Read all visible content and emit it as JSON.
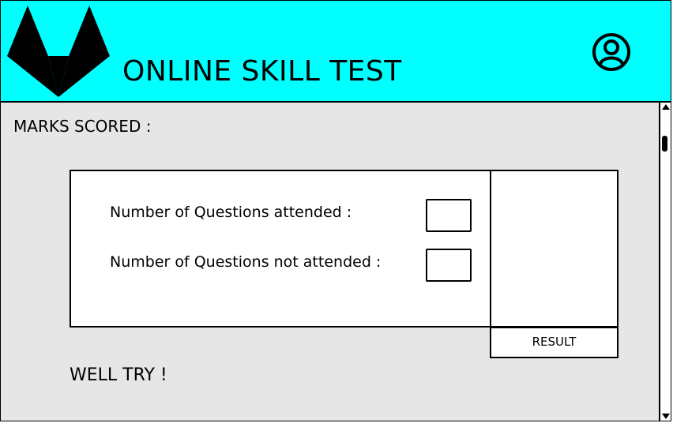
{
  "header": {
    "title": "ONLINE SKILL TEST",
    "background_color": "#00ffff",
    "logo_icon": "fox-logo-icon",
    "user_icon": "user-avatar-icon"
  },
  "main": {
    "marks_label": "MARKS SCORED  :",
    "questions_attended_label": "Number of Questions attended :",
    "questions_attended_value": "",
    "questions_not_attended_label": "Number of Questions not attended :",
    "questions_not_attended_value": "",
    "result_button_label": "RESULT",
    "feedback_text": "WELL TRY !",
    "background_color": "#e6e6e6"
  }
}
